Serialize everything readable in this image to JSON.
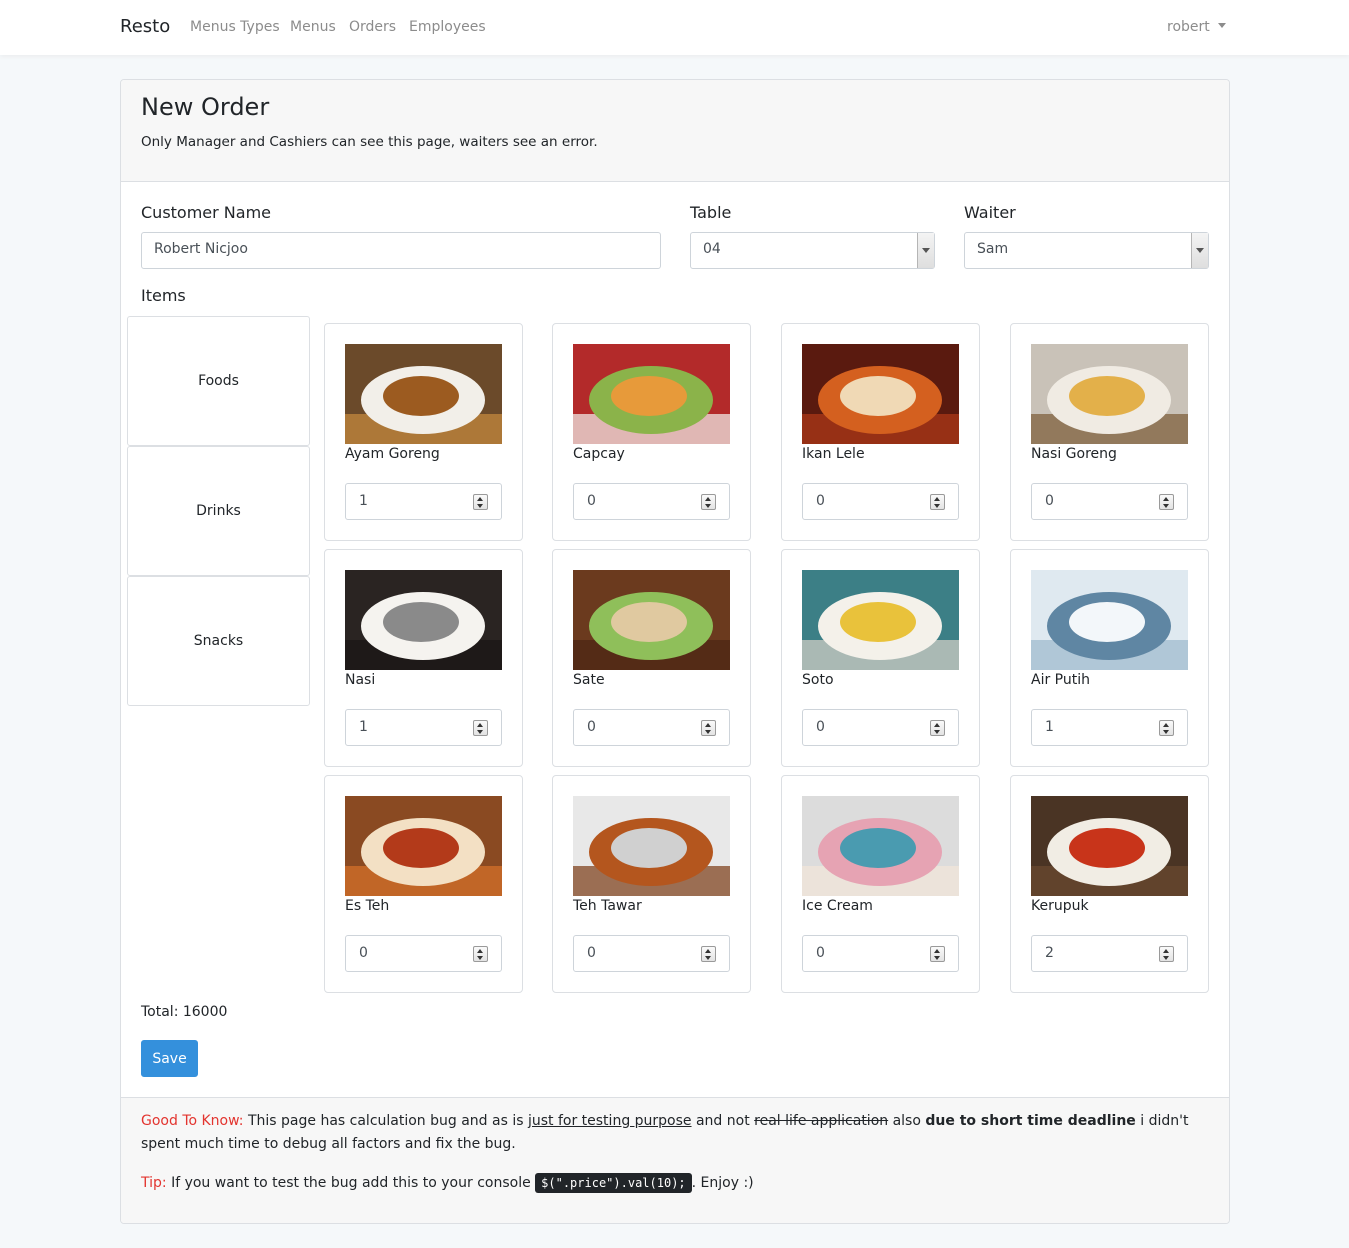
{
  "navbar": {
    "brand": "Resto",
    "links": [
      "Menus Types",
      "Menus",
      "Orders",
      "Employees"
    ],
    "user": "robert"
  },
  "header": {
    "title": "New Order",
    "note": "Only Manager and Cashiers can see this page, waiters see an error."
  },
  "form": {
    "customer_label": "Customer Name",
    "customer_value": "Robert Nicjoo",
    "table_label": "Table",
    "table_value": "04",
    "waiter_label": "Waiter",
    "waiter_value": "Sam",
    "items_label": "Items"
  },
  "categories": [
    "Foods",
    "Drinks",
    "Snacks"
  ],
  "items": [
    {
      "name": "Ayam Goreng",
      "qty": "1",
      "colors": [
        "#6b4a2a",
        "#c98b3e",
        "#f2efe9",
        "#9c5b20"
      ]
    },
    {
      "name": "Capcay",
      "qty": "0",
      "colors": [
        "#b32a2a",
        "#f4f4f0",
        "#8bb34a",
        "#e79a3a"
      ]
    },
    {
      "name": "Ikan Lele",
      "qty": "0",
      "colors": [
        "#5a1a0f",
        "#b13a18",
        "#d4601f",
        "#f0d9b5"
      ]
    },
    {
      "name": "Nasi Goreng",
      "qty": "0",
      "colors": [
        "#c9c2b8",
        "#7a5a34",
        "#f0ebe3",
        "#e3b04a"
      ]
    },
    {
      "name": "Nasi",
      "qty": "1",
      "colors": [
        "#2a2422",
        "#1a1614",
        "#f5f3ef",
        "#8a8a8a"
      ]
    },
    {
      "name": "Sate",
      "qty": "0",
      "colors": [
        "#6b3a1e",
        "#4a2512",
        "#8fbf5a",
        "#e0c9a0"
      ]
    },
    {
      "name": "Soto",
      "qty": "0",
      "colors": [
        "#3c7f86",
        "#d8d2c8",
        "#f4f1ea",
        "#e9c23b"
      ]
    },
    {
      "name": "Air Putih",
      "qty": "1",
      "colors": [
        "#dfe9f0",
        "#9bb8cc",
        "#5f86a3",
        "#f3f7fa"
      ]
    },
    {
      "name": "Es Teh",
      "qty": "0",
      "colors": [
        "#8a4a22",
        "#d9722a",
        "#f3e0c4",
        "#b33a1a"
      ]
    },
    {
      "name": "Teh Tawar",
      "qty": "0",
      "colors": [
        "#e8e8e8",
        "#7a3a14",
        "#b4561e",
        "#d0d0d0"
      ]
    },
    {
      "name": "Ice Cream",
      "qty": "0",
      "colors": [
        "#dcdcdc",
        "#f2e6d9",
        "#e6a3b3",
        "#4a9bb0"
      ]
    },
    {
      "name": "Kerupuk",
      "qty": "2",
      "colors": [
        "#4a3424",
        "#6b4a30",
        "#f1ede4",
        "#c8341a"
      ]
    }
  ],
  "total": "Total: 16000",
  "save_label": "Save",
  "footer": {
    "good_to_know": "Good To Know:",
    "t1": " This page has calculation bug and as is ",
    "t2": "just for testing purpose",
    "t3": " and not ",
    "t4": "real life application",
    "t5": " also ",
    "t6": "due to short time deadline",
    "t7": " i didn't spent much time to debug all factors and fix the bug.",
    "tip": "Tip:",
    "t8": " If you want to test the bug add this to your console ",
    "code": "$(\".price\").val(10);",
    "t9": ". Enjoy :)"
  }
}
